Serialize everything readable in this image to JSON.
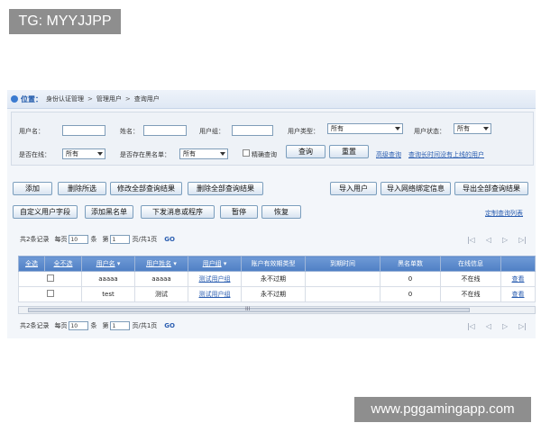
{
  "watermarks": {
    "top_left": "TG: MYYJJPP",
    "bottom_right": "www.pggamingapp.com"
  },
  "breadcrumb": {
    "position_label": "位置：",
    "items": [
      "身份认证管理",
      "管理用户",
      "查询用户"
    ],
    "separator": ">"
  },
  "filters": {
    "username_label": "用户名：",
    "name_label": "姓名：",
    "usergroup_label": "用户组：",
    "usertype_label": "用户类型：",
    "usertype_value": "所有",
    "userstatus_label": "用户状态：",
    "userstatus_value": "所有",
    "online_label": "是否在线：",
    "online_value": "所有",
    "blacklist_label": "是否存在黑名单：",
    "blacklist_value": "所有",
    "exact_label": "精确查询",
    "query_button": "查询",
    "reset_button": "重置",
    "advanced_link": "高级查询",
    "longtime_link": "查询长时间没有上线的用户"
  },
  "toolbar": {
    "add": "添加",
    "delete_selected": "删除所选",
    "modify_all": "修改全部查询结果",
    "delete_all": "删除全部查询结果",
    "import_users": "导入用户",
    "import_binding": "导入网络绑定信息",
    "export_all": "导出全部查询结果",
    "custom_fields": "自定义用户字段",
    "add_blacklist": "添加黑名单",
    "send_message": "下发消息或程序",
    "pause": "暂停",
    "resume": "恢复",
    "custom_list_link": "定制查询列表"
  },
  "pager": {
    "total": "共2条记录",
    "per_page_label": "每页",
    "per_page_value": "10",
    "unit": "条",
    "page_label": "第",
    "page_value": "1",
    "page_of": "页/共1页",
    "go": "GO",
    "nav_icons": [
      "first-page-icon",
      "prev-page-icon",
      "next-page-icon",
      "last-page-icon"
    ]
  },
  "table": {
    "headers": [
      "全选",
      "全不选",
      "用户名",
      "用户姓名",
      "用户组",
      "账户有效期类型",
      "到期时间",
      "黑名单数",
      "在线信息",
      ""
    ],
    "rows": [
      {
        "username": "aaaaa",
        "realname": "aaaaa",
        "group": "测试用户组",
        "expiry_type": "永不过期",
        "expiry": "",
        "blacklist": "0",
        "online": "不在线",
        "action": "查看"
      },
      {
        "username": "test",
        "realname": "测试",
        "group": "测试用户组",
        "expiry_type": "永不过期",
        "expiry": "",
        "blacklist": "0",
        "online": "不在线",
        "action": "查看"
      }
    ],
    "scroll_label": "III"
  },
  "colors": {
    "header_blue": "#5a87c9",
    "link": "#2a5db0",
    "watermark_bg": "#8e8e8e"
  }
}
